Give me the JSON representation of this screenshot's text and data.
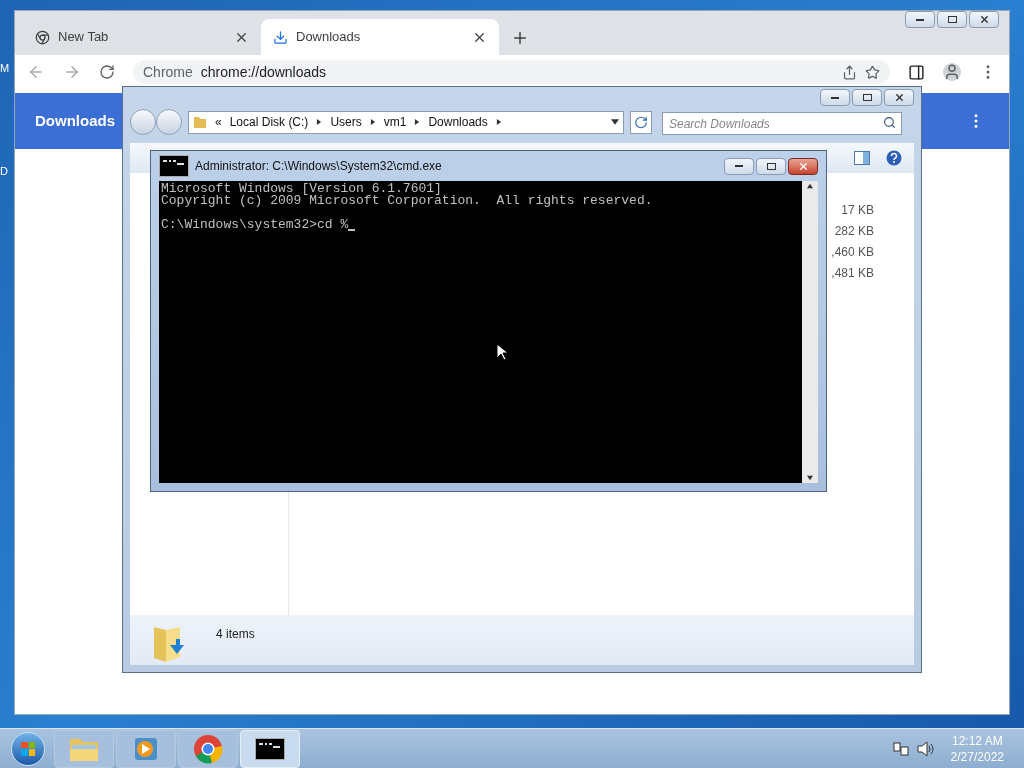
{
  "desktop_labels": [
    "M",
    "D"
  ],
  "chrome": {
    "tabs": [
      {
        "label": "New Tab",
        "selected": false
      },
      {
        "label": "Downloads",
        "selected": true
      }
    ],
    "address": {
      "site_label": "Chrome",
      "url": "chrome://downloads"
    },
    "page_title": "Downloads"
  },
  "explorer": {
    "breadcrumb": [
      "«",
      "Local Disk (C:)",
      "Users",
      "vm1",
      "Downloads"
    ],
    "search": {
      "placeholder": "Search Downloads"
    },
    "sizes": [
      "17 KB",
      "282 KB",
      ",460 KB",
      ",481 KB"
    ],
    "status": "4 items"
  },
  "cmd": {
    "title": "Administrator: C:\\Windows\\System32\\cmd.exe",
    "output": [
      "Microsoft Windows [Version 6.1.7601]",
      "Copyright (c) 2009 Microsoft Corporation.  All rights reserved."
    ],
    "prompt": "C:\\Windows\\system32>cd %"
  },
  "taskbar": {
    "items": [
      {
        "kind": "explorer",
        "selected": false
      },
      {
        "kind": "media",
        "selected": false
      },
      {
        "kind": "chrome",
        "selected": false
      },
      {
        "kind": "cmd",
        "selected": true
      }
    ],
    "time": "12:12 AM",
    "date": "2/27/2022"
  }
}
